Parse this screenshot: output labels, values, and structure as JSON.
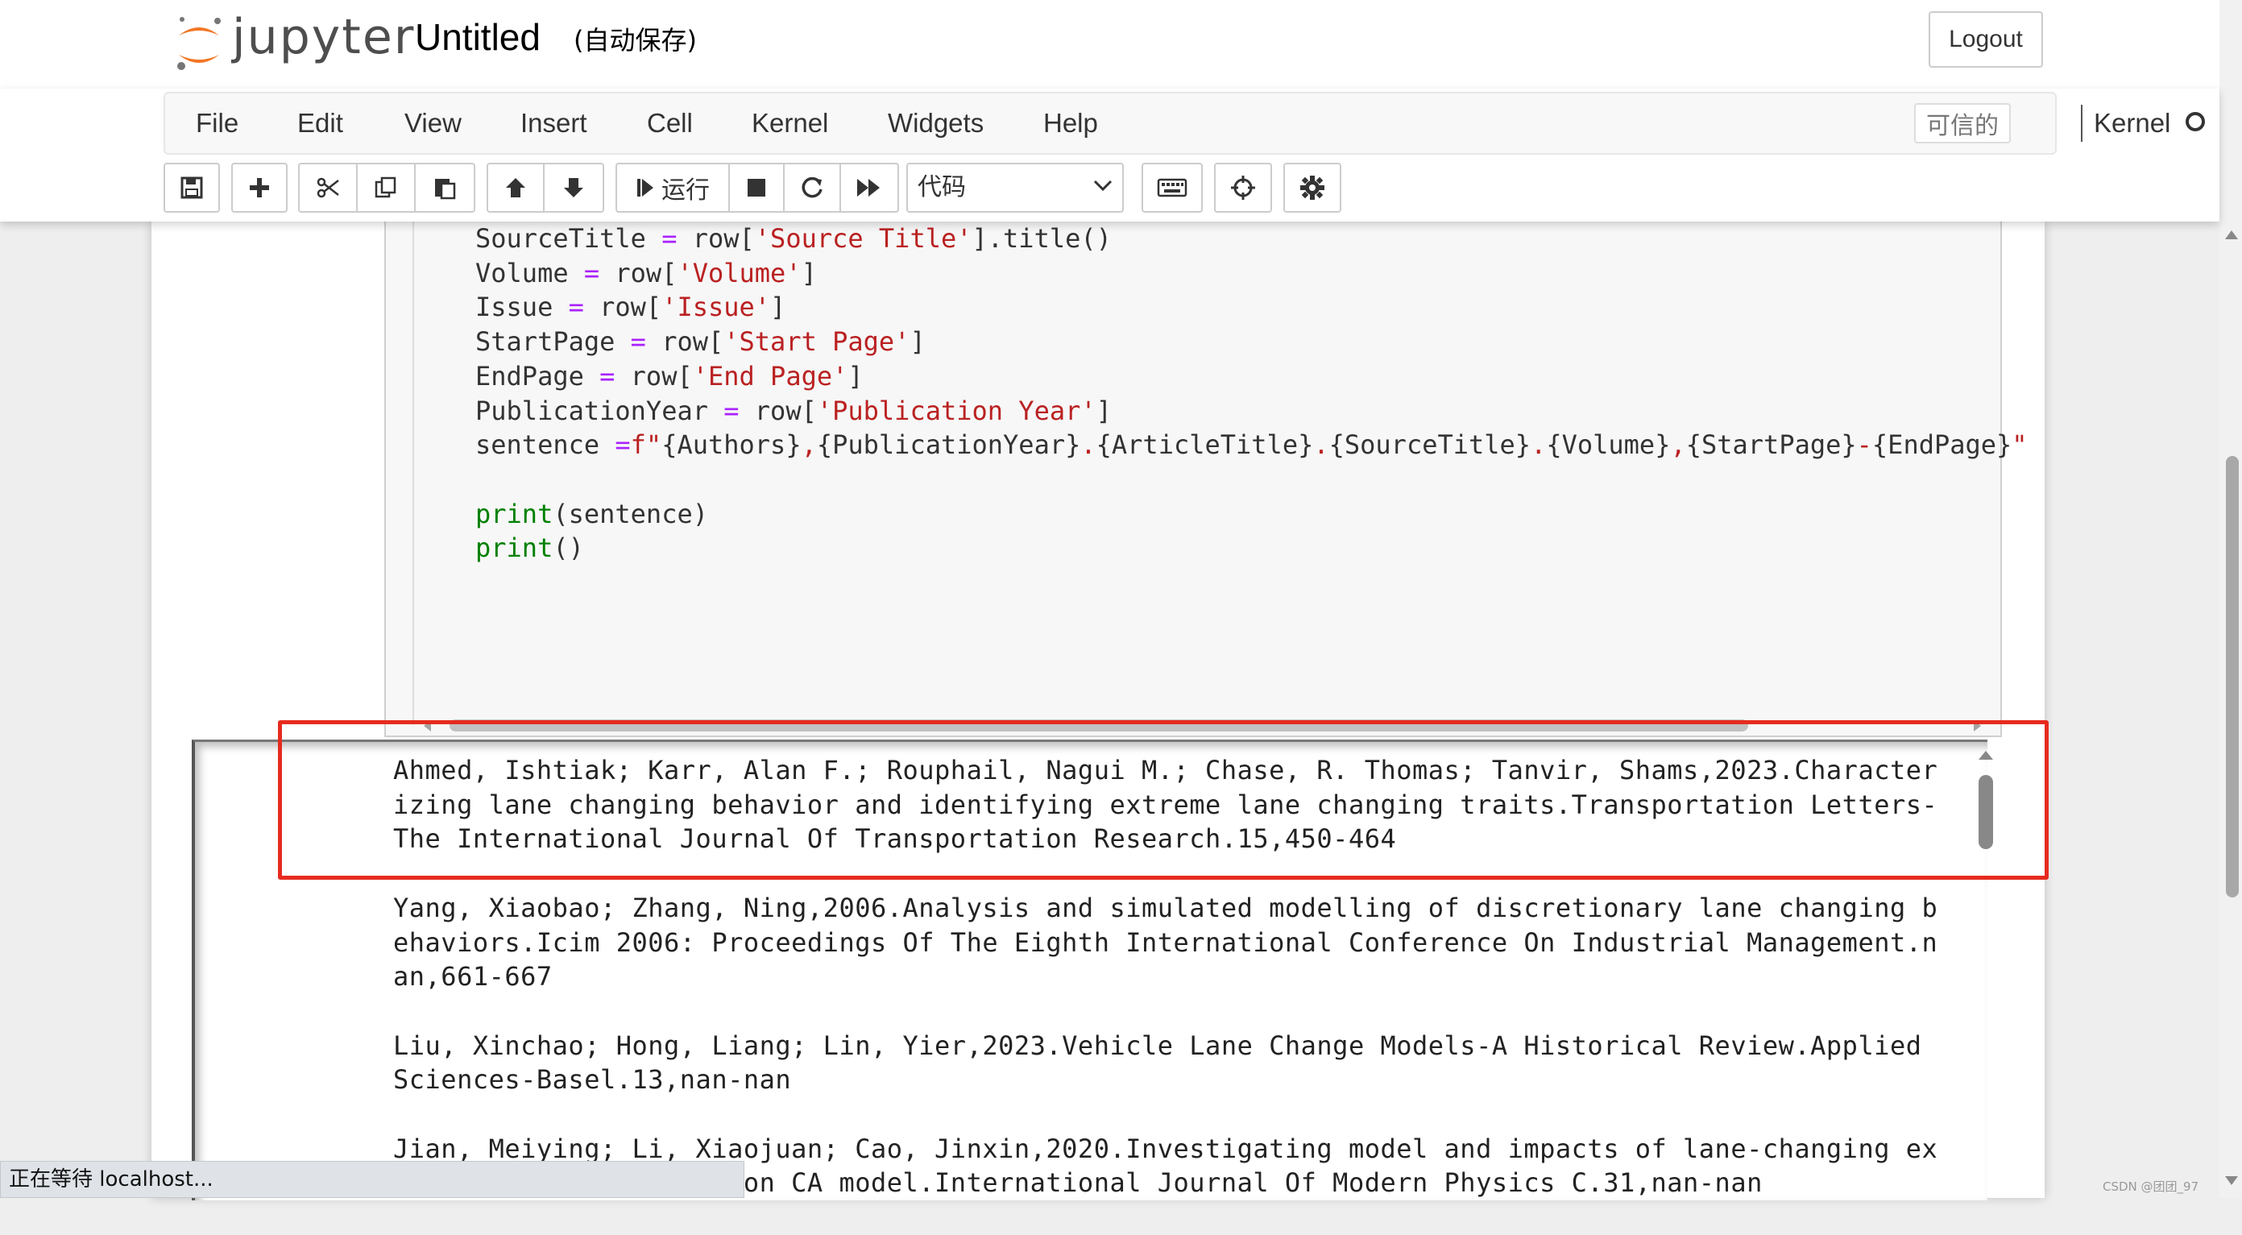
{
  "header": {
    "logo_text": "jupyter",
    "notebook_name": "Untitled",
    "autosave": "(自动保存)",
    "logout_label": "Logout"
  },
  "menubar": {
    "items": [
      "File",
      "Edit",
      "View",
      "Insert",
      "Cell",
      "Kernel",
      "Widgets",
      "Help"
    ],
    "trusted_label": "可信的",
    "kernel_label": "Kernel",
    "kernel_status": "idle"
  },
  "toolbar": {
    "run_label": "运行",
    "cell_type": "代码",
    "icons": [
      "save-icon",
      "plus-icon",
      "cut-icon",
      "copy-icon",
      "paste-icon",
      "arrow-up-icon",
      "arrow-down-icon",
      "step-forward-icon",
      "stop-icon",
      "restart-icon",
      "fast-forward-icon",
      "keyboard-icon",
      "crosshair-icon",
      "gear-icon"
    ]
  },
  "code": {
    "lines": [
      {
        "name": "SourceTitle",
        "op": " = ",
        "pre": "row[",
        "str": "'Source Title'",
        "post": "].title()"
      },
      {
        "name": "Volume",
        "op": " = ",
        "pre": "row[",
        "str": "'Volume'",
        "post": "]"
      },
      {
        "name": "Issue",
        "op": " = ",
        "pre": "row[",
        "str": "'Issue'",
        "post": "]"
      },
      {
        "name": "StartPage",
        "op": " = ",
        "pre": "row[",
        "str": "'Start Page'",
        "post": "]"
      },
      {
        "name": "EndPage",
        "op": " = ",
        "pre": "row[",
        "str": "'End Page'",
        "post": "]"
      },
      {
        "name": "PublicationYear",
        "op": " = ",
        "pre": "row[",
        "str": "'Publication Year'",
        "post": "]"
      }
    ],
    "sentence_line": {
      "lhs": "sentence ",
      "op": "=",
      "fstr_open": "f\"",
      "fstring_parts": [
        "{Authors}",
        ",",
        "{PublicationYear}",
        ".",
        "{ArticleTitle}",
        ".",
        "{SourceTitle}",
        ".",
        "{Volume}",
        ",",
        "{StartPage}",
        "-",
        "{EndPage}"
      ],
      "fstr_close": "\""
    },
    "print1": {
      "fn": "print",
      "args": "(sentence)"
    },
    "print2": {
      "fn": "print",
      "args": "()"
    }
  },
  "output": {
    "paragraphs": [
      "Ahmed, Ishtiak; Karr, Alan F.; Rouphail, Nagui M.; Chase, R. Thomas; Tanvir, Shams,2023.Characterizing lane changing behavior and identifying extreme lane changing traits.Transportation Letters-The International Journal Of Transportation Research.15,450-464",
      "Yang, Xiaobao; Zhang, Ning,2006.Analysis and simulated modelling of discretionary lane changing behaviors.Icim 2006: Proceedings Of The Eighth International Conference On Industrial Management.nan,661-667",
      "Liu, Xinchao; Hong, Liang; Lin, Yier,2023.Vehicle Lane Change Models-A Historical Review.Applied Sciences-Basel.13,nan-nan",
      "Jian, Meiying; Li, Xiaojuan; Cao, Jinxin,2020.Investigating model and impacts of lane-changing execution process based on CA model.International Journal Of Modern Physics C.31,nan-nan"
    ]
  },
  "statusbar": {
    "text": "正在等待 localhost..."
  },
  "watermark": {
    "text": "CSDN @团团_97"
  },
  "colors": {
    "highlight_box": "#e62b1e",
    "string": "#ba2121",
    "operator": "#aa22ff",
    "builtin": "#008000",
    "logo_orange": "#f37726"
  }
}
